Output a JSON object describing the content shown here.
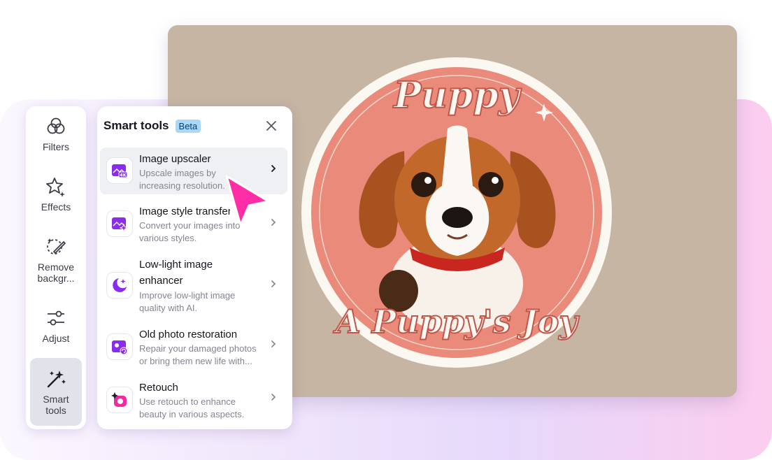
{
  "canvas": {
    "image_text_top": "Puppy",
    "image_text_bottom": "A Puppy's Joy"
  },
  "sidebar": {
    "items": [
      {
        "label": "Filters",
        "icon": "filters-icon"
      },
      {
        "label": "Effects",
        "icon": "effects-icon"
      },
      {
        "label": "Remove backgr...",
        "icon": "remove-background-icon"
      },
      {
        "label": "Adjust",
        "icon": "adjust-icon"
      },
      {
        "label": "Smart tools",
        "icon": "smart-tools-wand-icon",
        "active": true
      }
    ]
  },
  "panel": {
    "title": "Smart tools",
    "badge": "Beta",
    "tools": [
      {
        "name": "Image upscaler",
        "desc": "Upscale images by increasing resolution.",
        "icon": "image-upscaler-4k-icon"
      },
      {
        "name": "Image style transfer",
        "desc": "Convert your images into various styles.",
        "icon": "image-style-transfer-icon"
      },
      {
        "name": "Low-light image enhancer",
        "desc": "Improve low-light image quality with AI.",
        "icon": "moon-stars-icon"
      },
      {
        "name": "Old photo restoration",
        "desc": "Repair your damaged photos or bring them new life with...",
        "icon": "photo-restoration-icon"
      },
      {
        "name": "Retouch",
        "desc": "Use retouch to enhance beauty in various aspects.",
        "icon": "retouch-sparkle-icon"
      }
    ]
  },
  "colors": {
    "accent": "#8b2bf0",
    "cursor": "#ff2ea6",
    "canvas_bg": "#c5b5a2",
    "badge_bg": "#a9d8fb"
  }
}
